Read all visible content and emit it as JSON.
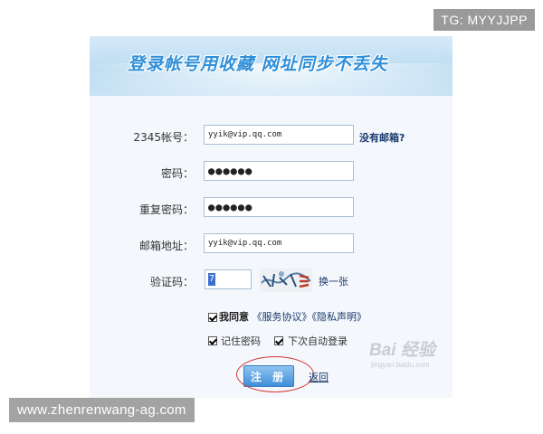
{
  "watermark_top": "TG: MYYJJPP",
  "watermark_bottom": "www.zhenrenwang-ag.com",
  "banner": {
    "text": "登录帐号用收藏  网址同步不丢失"
  },
  "form": {
    "account": {
      "label": "2345帐号：",
      "value": "yyik@vip.qq.com",
      "side_link": "没有邮箱?"
    },
    "password": {
      "label": "密码：",
      "value": "●●●●●●"
    },
    "confirm_password": {
      "label": "重复密码：",
      "value": "●●●●●●"
    },
    "email": {
      "label": "邮箱地址：",
      "value": "yyik@vip.qq.com"
    },
    "captcha": {
      "label": "验证码：",
      "value": "7",
      "refresh": "换一张"
    }
  },
  "agreement": {
    "agree": "我同意",
    "terms": "《服务协议》",
    "privacy": "《隐私声明》",
    "checked": true
  },
  "remember_password": {
    "label": "记住密码",
    "checked": true
  },
  "auto_login": {
    "label": "下次自动登录",
    "checked": true
  },
  "register_button": "注 册",
  "back_link": "返回",
  "baidu_watermark": {
    "logo": "Bai 经验",
    "url": "jingyan.baidu.com"
  },
  "colors": {
    "accent": "#2f8fd8",
    "button": "#3f8fda",
    "highlight_circle": "#d43a3a"
  }
}
